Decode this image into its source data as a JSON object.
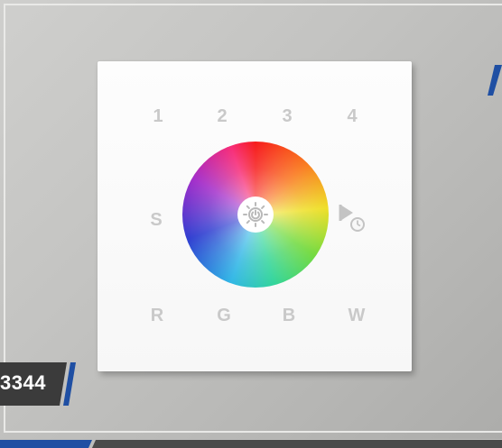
{
  "labels": {
    "top": [
      "1",
      "2",
      "3",
      "4"
    ],
    "side_left": "S",
    "bottom": [
      "R",
      "G",
      "B",
      "W"
    ]
  },
  "badge": {
    "text": "3344"
  },
  "colors": {
    "background": "#bdbdbb",
    "panel": "#f8f8f8",
    "label_gray": "#c9c9c9",
    "badge_dark": "#3b3b3b",
    "accent_blue": "#1f4fa3"
  },
  "icons": {
    "center": "power-sun-icon",
    "side_right": "play-timer-icon"
  }
}
